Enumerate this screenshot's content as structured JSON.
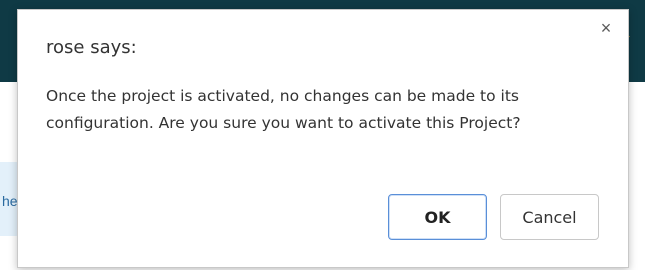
{
  "background": {
    "partial_tab_text": "he"
  },
  "dialog": {
    "title": "rose says:",
    "message": "Once the project is activated, no changes can be made to its configuration. Are you sure you want to activate this Project?",
    "close_glyph": "×",
    "ok_label": "OK",
    "cancel_label": "Cancel"
  },
  "colors": {
    "header_bg": "#0f3a45",
    "ok_border": "#5a8fd8"
  },
  "icons": {
    "close": "close-icon",
    "accent": "pencil-icon"
  }
}
